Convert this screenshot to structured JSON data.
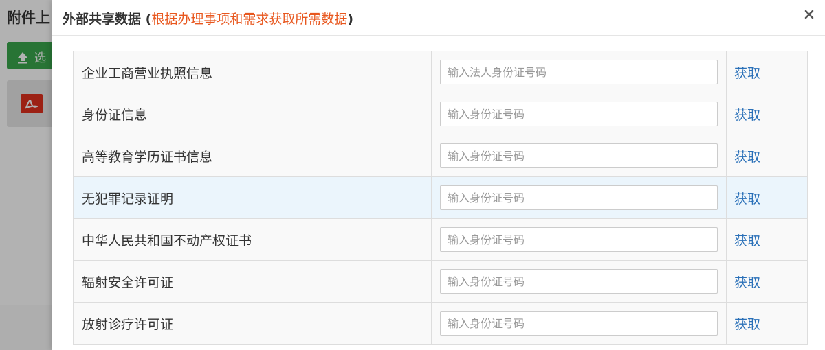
{
  "background": {
    "page_title": "附件上",
    "upload_button_label": "选"
  },
  "modal": {
    "title": "外部共享数据",
    "hint_open": "(",
    "hint": "根据办理事项和需求获取所需数据",
    "hint_close": ")",
    "close_icon": "close-icon"
  },
  "rows": [
    {
      "name": "企业工商营业执照信息",
      "placeholder": "输入法人身份证号码",
      "action": "获取"
    },
    {
      "name": "身份证信息",
      "placeholder": "输入身份证号码",
      "action": "获取"
    },
    {
      "name": "高等教育学历证书信息",
      "placeholder": "输入身份证号码",
      "action": "获取"
    },
    {
      "name": "无犯罪记录证明",
      "placeholder": "输入身份证号码",
      "action": "获取"
    },
    {
      "name": "中华人民共和国不动产权证书",
      "placeholder": "输入身份证号码",
      "action": "获取"
    },
    {
      "name": "辐射安全许可证",
      "placeholder": "输入身份证号码",
      "action": "获取"
    },
    {
      "name": "放射诊疗许可证",
      "placeholder": "输入身份证号码",
      "action": "获取"
    }
  ],
  "colors": {
    "hint": "#e8571e",
    "link": "#2a70b8",
    "highlight_row": "#ebf5fc",
    "upload_button": "#3aa64c"
  }
}
